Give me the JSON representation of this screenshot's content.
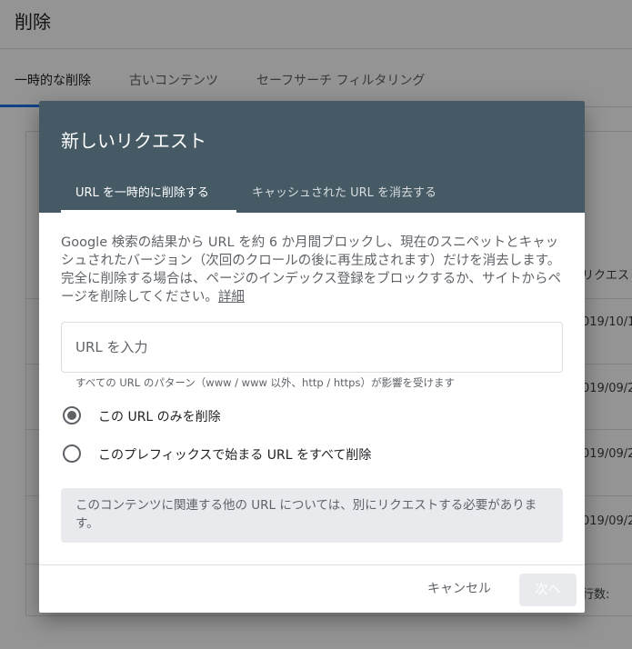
{
  "page": {
    "title": "削除",
    "tabs": [
      {
        "label": "一時的な削除",
        "active": true
      },
      {
        "label": "古いコンテンツ",
        "active": false
      },
      {
        "label": "セーフサーチ フィルタリング",
        "active": false
      }
    ],
    "table": {
      "header_fragment": "リクエスト",
      "rows": [
        "019/10/1",
        "019/09/2",
        "019/09/2",
        "019/09/2"
      ],
      "footer_fragment": "行数:"
    }
  },
  "dialog": {
    "title": "新しいリクエスト",
    "tabs": [
      {
        "label": "URL を一時的に削除する",
        "active": true
      },
      {
        "label": "キャッシュされた URL を消去する",
        "active": false
      }
    ],
    "description": "Google 検索の結果から URL を約 6 か月間ブロックし、現在のスニペットとキャッシュされたバージョン（次回のクロールの後に再生成されます）だけを消去します。完全に削除する場合は、ページのインデックス登録をブロックするか、サイトからページを削除してください。",
    "description_link": "詳細",
    "url_input": {
      "value": "",
      "placeholder": "URL を入力"
    },
    "helper_text": "すべての URL のパターン（www / www 以外、http / https）が影響を受けます",
    "options": [
      {
        "label": "この URL のみを削除",
        "selected": true
      },
      {
        "label": "このプレフィックスで始まる URL をすべて削除",
        "selected": false
      }
    ],
    "note": "このコンテンツに関連する他の URL については、別にリクエストする必要があります。",
    "buttons": {
      "cancel": "キャンセル",
      "next": "次へ"
    }
  },
  "colors": {
    "dialog_header": "#455a64",
    "note_background": "#e8eaed",
    "accent": "#1a73e8"
  }
}
